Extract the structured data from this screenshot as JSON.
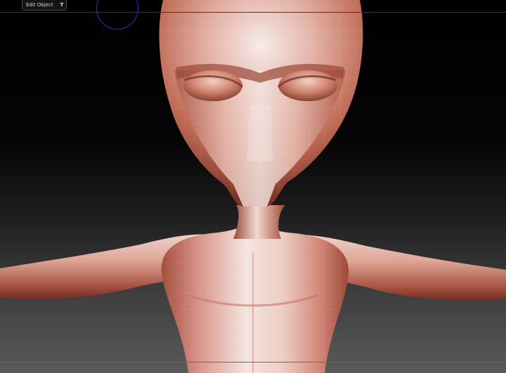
{
  "toolbar": {
    "edit_object_label": "Edit Object",
    "edit_object_hotkey": "T"
  },
  "viewport": {
    "background_top": "#000000",
    "background_bottom": "#5a5a5a",
    "brush_cursor_color": "#2a36b8",
    "material_color": "#b8604c",
    "model_subject": "alien-humanoid-sculpt"
  }
}
